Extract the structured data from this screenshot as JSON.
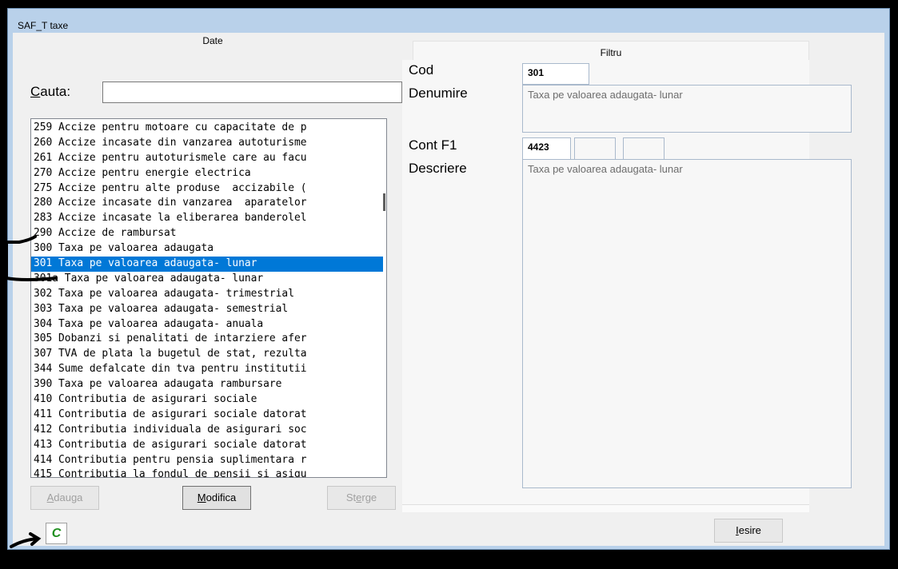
{
  "window": {
    "title": "SAF_T taxe"
  },
  "tabs": [
    {
      "label": "Date"
    },
    {
      "label": "Filtru"
    }
  ],
  "search": {
    "label_first": "C",
    "label_rest": "auta:",
    "value": ""
  },
  "list": {
    "items": [
      "259 Accize pentru motoare cu capacitate de p",
      "260 Accize incasate din vanzarea autoturisme",
      "261 Accize pentru autoturismele care au facu",
      "270 Accize pentru energie electrica",
      "275 Accize pentru alte produse  accizabile (",
      "280 Accize incasate din vanzarea  aparatelor",
      "283 Accize incasate la eliberarea banderolel",
      "290 Accize de rambursat",
      "300 Taxa pe valoarea adaugata",
      "301 Taxa pe valoarea adaugata- lunar",
      "301a Taxa pe valoarea adaugata- lunar",
      "302 Taxa pe valoarea adaugata- trimestrial",
      "303 Taxa pe valoarea adaugata- semestrial",
      "304 Taxa pe valoarea adaugata- anuala",
      "305 Dobanzi si penalitati de intarziere afer",
      "307 TVA de plata la bugetul de stat, rezulta",
      "344 Sume defalcate din tva pentru institutii",
      "390 Taxa pe valoarea adaugata rambursare",
      "410 Contributia de asigurari sociale",
      "411 Contributia de asigurari sociale datorat",
      "412 Contributia individuala de asigurari soc",
      "413 Contributia de asigurari sociale datorat",
      "414 Contributia pentru pensia suplimentara r",
      "415 Contributia la fondul de pensii si asigu"
    ],
    "selected_index": 9
  },
  "buttons": {
    "adauga_first": "A",
    "adauga_rest": "dauga",
    "modifica_first": "M",
    "modifica_rest": "odifica",
    "sterge_pre": "St",
    "sterge_u": "e",
    "sterge_rest": "rge",
    "iesire_first": "I",
    "iesire_rest": "esire",
    "calc": "C"
  },
  "filtru": {
    "cod_label": "Cod",
    "cod_value": "301",
    "denumire_label": "Denumire",
    "denumire_value": "Taxa pe valoarea adaugata- lunar",
    "cont_label": "Cont F1",
    "cont_values": [
      "4423",
      "",
      ""
    ],
    "descriere_label": "Descriere",
    "descriere_value": "Taxa pe valoarea adaugata- lunar"
  },
  "colors": {
    "selection": "#0078d7",
    "calc_icon": "#1f8f1f"
  }
}
